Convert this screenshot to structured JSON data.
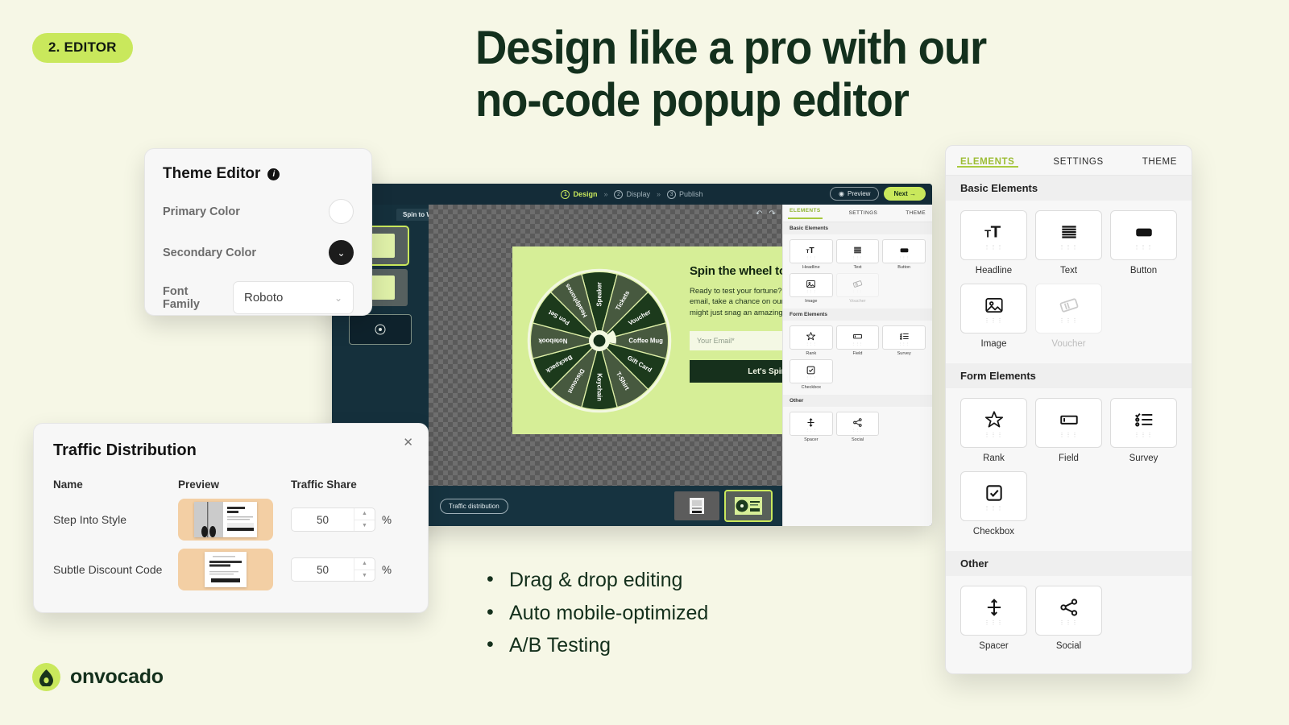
{
  "badge": {
    "label": "2. EDITOR"
  },
  "headline": {
    "line1": "Design like a pro with our",
    "line2": "no-code popup editor"
  },
  "bullets": [
    {
      "label": "Drag & drop editing"
    },
    {
      "label": "Auto mobile-optimized"
    },
    {
      "label": "A/B Testing"
    }
  ],
  "logo": {
    "wordmark": "onvocado",
    "icon": "avocado-icon"
  },
  "colors": {
    "page_background": "#f6f7e6",
    "accent_lime": "#c9e85c",
    "dark_green": "#13301d",
    "editor_navy": "#15303c",
    "popup_green": "#d6ee97",
    "preview_peach": "#f3cfa4"
  },
  "theme_editor": {
    "title": "Theme Editor",
    "info_icon": "info-icon",
    "primary_color_label": "Primary Color",
    "primary_color_value": "#ffffff",
    "secondary_color_label": "Secondary Color",
    "secondary_color_value": "#1c1c1c",
    "font_family_label_line1": "Font",
    "font_family_label_line2": "Family",
    "font_family_value": "Roboto"
  },
  "traffic_distribution": {
    "title": "Traffic Distribution",
    "close_icon": "close-icon",
    "columns": [
      "Name",
      "Preview",
      "Traffic Share"
    ],
    "rows": [
      {
        "name": "Step Into Style",
        "share": "50",
        "unit": "%"
      },
      {
        "name": "Subtle Discount Code",
        "share": "50",
        "unit": "%"
      }
    ]
  },
  "editor": {
    "steps": [
      {
        "num": "1",
        "label": "Design",
        "active": true
      },
      {
        "num": "2",
        "label": "Display",
        "active": false
      },
      {
        "num": "3",
        "label": "Publish",
        "active": false
      }
    ],
    "separator": "»",
    "preview_button": "Preview",
    "preview_icon": "eye-icon",
    "next_button": "Next →",
    "tab_label": "Spin to Win ✎",
    "undo_icon": "undo-icon",
    "redo_icon": "redo-icon",
    "add_icon": "add-circle-icon",
    "bottom_bar": {
      "traffic_pill": "Traffic distribution",
      "variants": [
        {
          "name": "variant-a",
          "selected": false
        },
        {
          "name": "variant-b",
          "selected": true
        }
      ]
    }
  },
  "popup": {
    "close_icon": "close-icon",
    "headline": "Spin the wheel to win!",
    "body": "Ready to test your fortune? Just enter your email, take a chance on our wheel, and you might just snag an amazing prize!",
    "email_placeholder": "Your Email*",
    "submit_button": "Let's Spin",
    "wheel_segments": [
      "Speaker",
      "Tickets",
      "Voucher",
      "Coffee Mug",
      "Gift Card",
      "T-Shirt",
      "Keychain",
      "Discount",
      "Backpack",
      "Notebook",
      "Pen Set",
      "Headphones"
    ]
  },
  "elements_panel": {
    "tabs": [
      {
        "label": "ELEMENTS",
        "active": true
      },
      {
        "label": "SETTINGS",
        "active": false
      },
      {
        "label": "THEME",
        "active": false
      }
    ],
    "sections": [
      {
        "title": "Basic Elements",
        "items": [
          {
            "label": "Headline",
            "icon": "headline-icon",
            "disabled": false
          },
          {
            "label": "Text",
            "icon": "text-icon",
            "disabled": false
          },
          {
            "label": "Button",
            "icon": "button-icon",
            "disabled": false
          },
          {
            "label": "Image",
            "icon": "image-icon",
            "disabled": false
          },
          {
            "label": "Voucher",
            "icon": "voucher-icon",
            "disabled": true
          }
        ]
      },
      {
        "title": "Form Elements",
        "items": [
          {
            "label": "Rank",
            "icon": "star-icon",
            "disabled": false
          },
          {
            "label": "Field",
            "icon": "field-icon",
            "disabled": false
          },
          {
            "label": "Survey",
            "icon": "survey-icon",
            "disabled": false
          },
          {
            "label": "Checkbox",
            "icon": "checkbox-icon",
            "disabled": false
          }
        ]
      },
      {
        "title": "Other",
        "items": [
          {
            "label": "Spacer",
            "icon": "spacer-icon",
            "disabled": false
          },
          {
            "label": "Social",
            "icon": "share-icon",
            "disabled": false
          }
        ]
      }
    ]
  }
}
